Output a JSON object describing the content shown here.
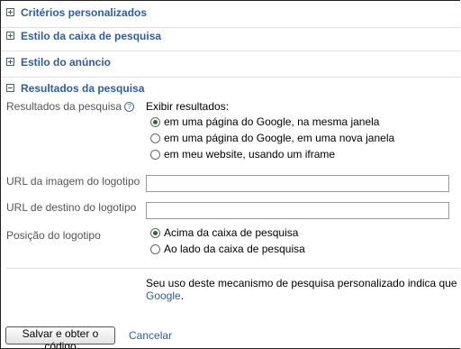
{
  "sections": [
    {
      "title": "Critérios personalizados",
      "state": "collapsed"
    },
    {
      "title": "Estilo da caixa de pesquisa",
      "state": "collapsed"
    },
    {
      "title": "Estilo do anúncio",
      "state": "collapsed"
    },
    {
      "title": "Resultados da pesquisa",
      "state": "expanded"
    }
  ],
  "results": {
    "label": "Resultados da pesquisa",
    "help_icon": "question-icon",
    "display_heading": "Exibir resultados:",
    "options": [
      {
        "label": "em uma página do Google, na mesma janela",
        "checked": true
      },
      {
        "label": "em uma página do Google, em uma nova janela",
        "checked": false
      },
      {
        "label": "em meu website, usando um iframe",
        "checked": false
      }
    ]
  },
  "logo_image_url": {
    "label": "URL da imagem do logotipo",
    "value": ""
  },
  "logo_dest_url": {
    "label": "URL de destino do logotipo",
    "value": ""
  },
  "logo_position": {
    "label": "Posição do logotipo",
    "options": [
      {
        "label": "Acima da caixa de pesquisa",
        "checked": true
      },
      {
        "label": "Ao lado da caixa de pesquisa",
        "checked": false
      }
    ]
  },
  "tos": {
    "text": "Seu uso deste mecanismo de pesquisa personalizado indica que você le",
    "link": "Google",
    "after": "."
  },
  "actions": {
    "save_label": "Salvar e obter o código",
    "cancel_label": "Cancelar"
  },
  "colors": {
    "link": "#2a5db0",
    "radio_checked": "#2c6e2c"
  }
}
